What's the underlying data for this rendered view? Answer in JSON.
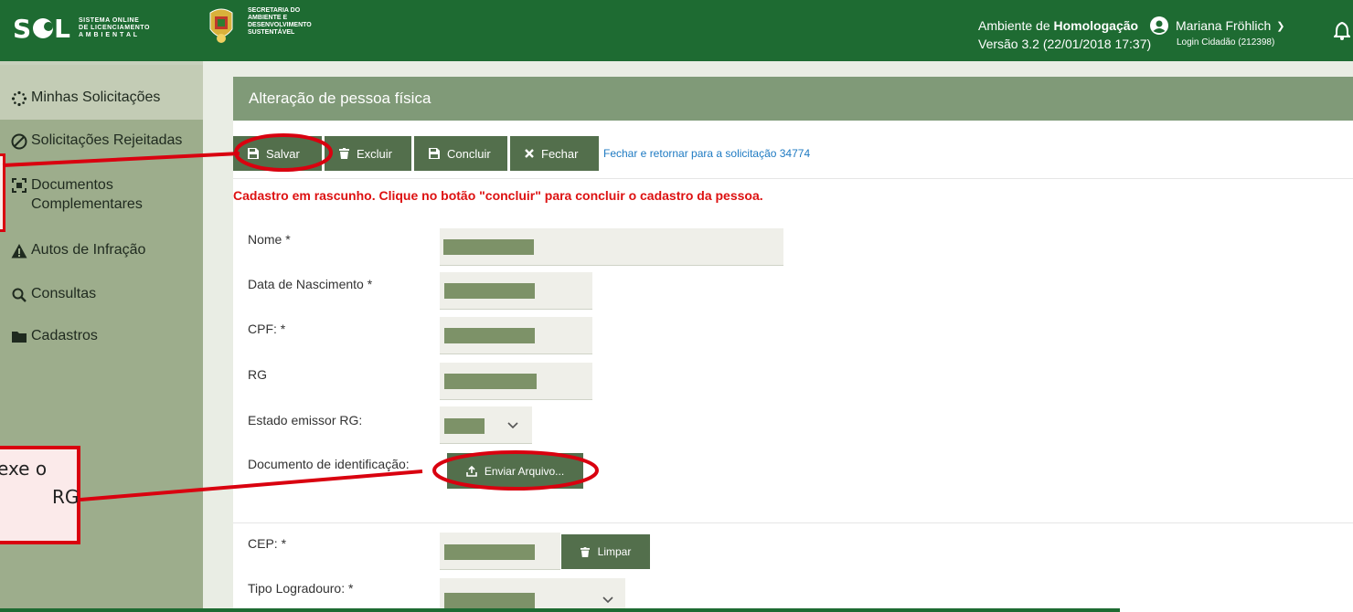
{
  "header": {
    "logo_text": "S  L",
    "logo_sub": [
      "SISTEMA ONLINE",
      "DE LICENCIAMENTO",
      "A M B I E N T A L"
    ],
    "secretaria": [
      "SECRETARIA DO",
      "AMBIENTE E",
      "DESENVOLVIMENTO",
      "SUSTENTÁVEL"
    ],
    "env_prefix": "Ambiente de ",
    "env_name": "Homologação",
    "version": "Versão 3.2 (22/01/2018 17:37)",
    "user_name": "Mariana Fröhlich",
    "login_info": "Login Cidadão (212398)"
  },
  "sidebar": {
    "items": [
      {
        "label": "Minhas Solicitações",
        "icon": "spinner-icon"
      },
      {
        "label": "Solicitações Rejeitadas",
        "icon": "ban-icon"
      },
      {
        "label": "Documentos Complementares",
        "icon": "document-bracket-icon"
      },
      {
        "label": "Autos de Infração",
        "icon": "warning-icon"
      },
      {
        "label": "Consultas",
        "icon": "search-icon"
      },
      {
        "label": "Cadastros",
        "icon": "folder-icon"
      }
    ]
  },
  "panel": {
    "title": "Alteração de pessoa física",
    "toolbar": {
      "save": "Salvar",
      "delete": "Excluir",
      "conclude": "Concluir",
      "close": "Fechar",
      "return_link": "Fechar e retornar para a solicitação 34774"
    },
    "draft_message": "Cadastro em rascunho. Clique no botão \"concluir\" para concluir o cadastro da pessoa."
  },
  "form": {
    "nome": "Nome *",
    "nascimento": "Data de Nascimento *",
    "cpf": "CPF: *",
    "rg": "RG",
    "estado_rg": "Estado emissor RG:",
    "documento": "Documento de identificação:",
    "upload_button": "Enviar Arquivo...",
    "cep": "CEP: *",
    "clear_button": "Limpar",
    "tipo_logradouro": "Tipo Logradouro: *"
  },
  "annotation": {
    "callout_lines": [
      "exe o",
      "RG"
    ]
  },
  "colors": {
    "header_green": "#1e6b32",
    "sidebar_green": "#9dad8c",
    "button_green": "#536f4c",
    "annotation_red": "#d9000f",
    "draft_red": "#dd1111"
  }
}
